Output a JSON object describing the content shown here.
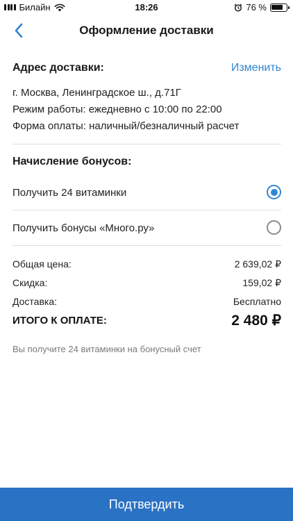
{
  "status_bar": {
    "carrier": "Билайн",
    "time": "18:26",
    "battery_percent": "76 %",
    "battery_level": 0.76
  },
  "nav": {
    "title": "Оформление доставки"
  },
  "address": {
    "heading": "Адрес доставки:",
    "change_label": "Изменить",
    "line1": "г. Москва, Ленинградское ш., д.71Г",
    "line2": "Режим работы: ежедневно с 10:00 по 22:00",
    "line3": "Форма оплаты: наличный/безналичный расчет"
  },
  "bonuses": {
    "heading": "Начисление бонусов:",
    "options": [
      {
        "label": "Получить 24 витаминки",
        "selected": true
      },
      {
        "label": "Получить бонусы «Много.ру»",
        "selected": false
      }
    ]
  },
  "summary": {
    "total_price_label": "Общая цена:",
    "total_price_value": "2 639,02 ₽",
    "discount_label": "Скидка:",
    "discount_value": "159,02 ₽",
    "delivery_label": "Доставка:",
    "delivery_value": "Бесплатно",
    "grand_total_label": "ИТОГО К ОПЛАТЕ:",
    "grand_total_value": "2 480 ₽",
    "note": "Вы получите 24 витаминки на бонусный счет"
  },
  "confirm_label": "Подтвердить",
  "colors": {
    "accent": "#2f86d4",
    "button": "#2a72c4"
  }
}
